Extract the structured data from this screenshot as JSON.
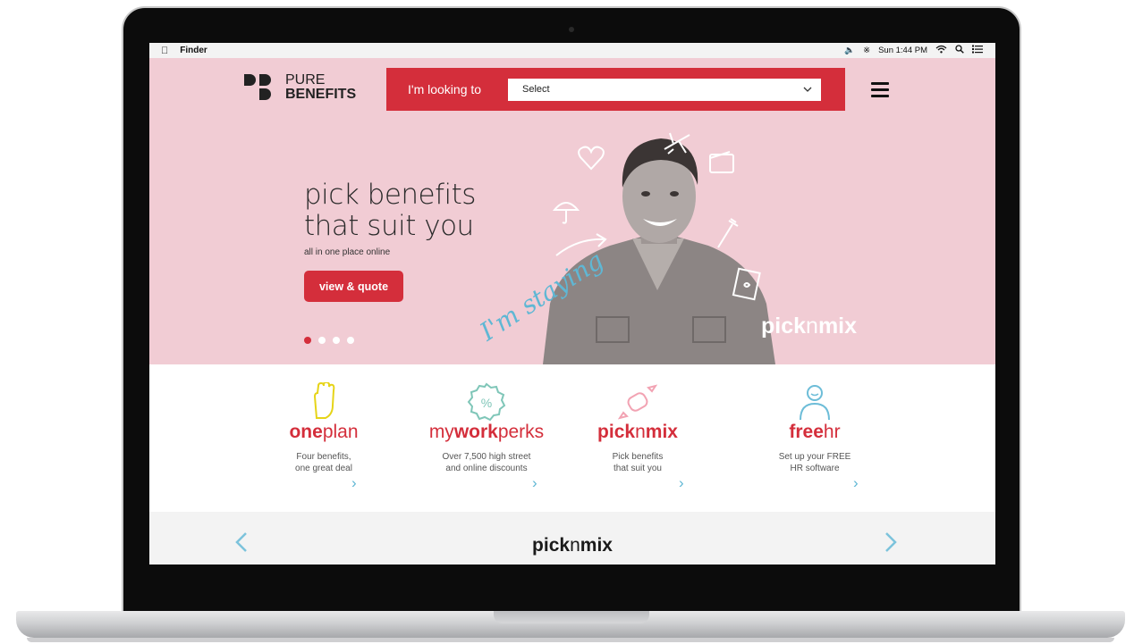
{
  "menubar": {
    "app": "Finder",
    "clock": "Sun 1:44 PM"
  },
  "logo": {
    "line1": "PURE",
    "line2": "BENEFITS"
  },
  "search": {
    "label": "I'm looking to",
    "select_value": "Select"
  },
  "hero": {
    "headline_line1": "pick benefits",
    "headline_line2": "that suit you",
    "subline": "all in one place online",
    "cta_label": "view & quote",
    "overlay_text": "I'm staying",
    "brand_bold1": "pick",
    "brand_n": "n",
    "brand_bold2": "mix",
    "slides_total": 4,
    "active_slide": 1
  },
  "products": [
    {
      "name_a": "one",
      "name_b": "plan",
      "desc1": "Four benefits,",
      "desc2": "one great deal",
      "icon": "hand-icon"
    },
    {
      "name_a": "my",
      "name_b": "work",
      "name_c": "perks",
      "desc1": "Over 7,500 high street",
      "desc2": "and online discounts",
      "icon": "percent-badge-icon"
    },
    {
      "name_a": "pick",
      "name_b": "n",
      "name_c": "mix",
      "desc1": "Pick benefits",
      "desc2": "that suit you",
      "icon": "candy-icon"
    },
    {
      "name_a": "free",
      "name_b": "hr",
      "desc1": "Set up your FREE",
      "desc2": "HR software",
      "icon": "person-icon"
    }
  ],
  "bottom": {
    "title_a": "pick",
    "title_b": "n",
    "title_c": "mix"
  },
  "colors": {
    "brand_red": "#d42e3b",
    "hero_pink": "#f1ccd4",
    "accent_blue": "#5fb7d4"
  }
}
